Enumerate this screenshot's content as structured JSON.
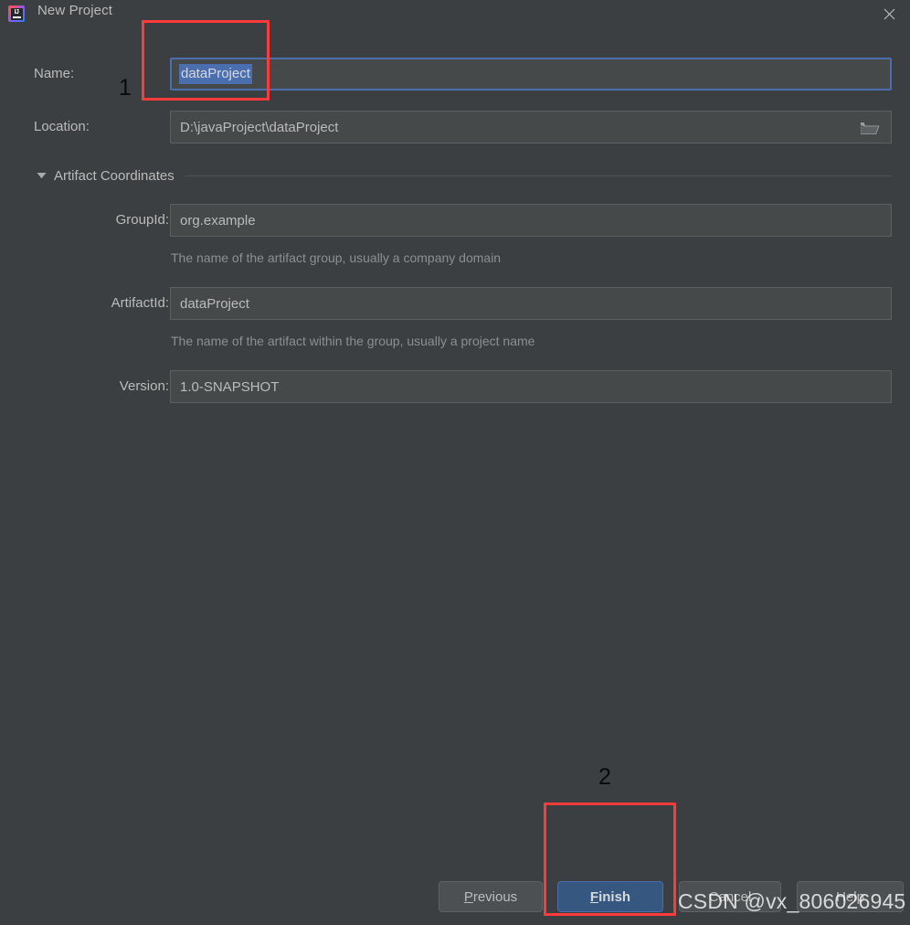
{
  "window": {
    "title": "New Project",
    "app_icon": "intellij-idea-icon",
    "close_icon": "close-icon"
  },
  "form": {
    "name": {
      "label": "Name:",
      "value": "dataProject",
      "selected": true,
      "focused": true
    },
    "location": {
      "label": "Location:",
      "value": "D:\\javaProject\\dataProject",
      "browse_icon": "folder-icon"
    },
    "section": {
      "title": "Artifact Coordinates",
      "expanded": true,
      "triangle_icon": "chevron-down-icon"
    },
    "group_id": {
      "label": "GroupId:",
      "value": "org.example",
      "hint": "The name of the artifact group, usually a company domain"
    },
    "artifact_id": {
      "label": "ArtifactId:",
      "value": "dataProject",
      "hint": "The name of the artifact within the group, usually a project name"
    },
    "version": {
      "label": "Version:",
      "value": "1.0-SNAPSHOT"
    }
  },
  "buttons": {
    "previous": {
      "label": "Previous",
      "mnemonic": "P",
      "rest": "revious"
    },
    "finish": {
      "label": "Finish",
      "mnemonic": "F",
      "rest": "inish",
      "primary": true
    },
    "cancel": {
      "label": "Cancel",
      "mnemonic": "",
      "rest": "Cancel"
    },
    "help": {
      "label": "Help",
      "mnemonic": "",
      "rest": "Help"
    }
  },
  "annotations": {
    "step1": "1",
    "step2": "2",
    "box_color": "#fd3b3b"
  },
  "watermark": "CSDN @vx_806026945",
  "colors": {
    "background": "#3c3f41",
    "field_background": "#45494a",
    "field_border": "#5e6060",
    "accent_blue": "#4b6eaf",
    "primary_button": "#365880",
    "text": "#bbbbbb",
    "hint_text": "#8c8f91",
    "annotation_red": "#fd3b3b"
  }
}
